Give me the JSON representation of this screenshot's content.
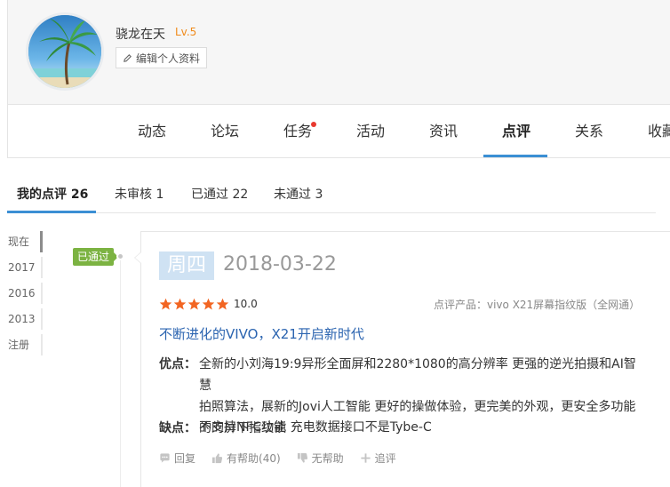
{
  "profile": {
    "username": "骁龙在天",
    "level": "Lv.5",
    "edit_label": "编辑个人资料"
  },
  "nav": {
    "items": [
      {
        "label": "动态"
      },
      {
        "label": "论坛"
      },
      {
        "label": "任务"
      },
      {
        "label": "活动"
      },
      {
        "label": "资讯"
      },
      {
        "label": "点评"
      },
      {
        "label": "关系"
      },
      {
        "label": "收藏"
      }
    ],
    "active": "点评"
  },
  "tabs": [
    {
      "label": "我的点评 26"
    },
    {
      "label": "未审核 1"
    },
    {
      "label": "已通过 22"
    },
    {
      "label": "未通过 3"
    }
  ],
  "timeline": {
    "years": [
      "现在",
      "2017",
      "2016",
      "2013",
      "注册"
    ]
  },
  "review": {
    "status": "已通过",
    "weekday": "周四",
    "date": "2018-03-22",
    "rating": 5,
    "score": "10.0",
    "product": "点评产品：vivo X21屏幕指纹版（全网通）",
    "title": "不断进化的VIVO，X21开启新时代",
    "pros_label": "优点：",
    "pros_line1": "全新的小刘海19:9异形全面屏和2280*1080的高分辨率 更强的逆光拍摄和AI智慧",
    "pros_line2": "拍照算法，展新的Jovi人工智能 更好的操做体验，更完美的外观，更安全多功能",
    "pros_line3": "的的屏下指纹锁",
    "cons_label": "缺点：",
    "cons": "不支持NFC功能 充电数据接口不是Tybe-C",
    "actions": {
      "reply": "回复",
      "helpful": "有帮助(40)",
      "unhelpful": "无帮助",
      "followup": "追评"
    }
  },
  "colors": {
    "accent": "#3b8fd4",
    "approved": "#7cb342",
    "star": "#f26522",
    "title_link": "#2b64b0",
    "level": "#f08a1a"
  }
}
